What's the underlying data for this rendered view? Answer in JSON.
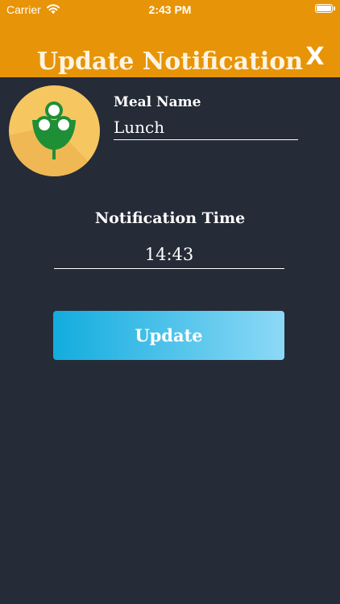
{
  "status_bar": {
    "carrier": "Carrier",
    "time": "2:43 PM"
  },
  "header": {
    "title": "Update Notification",
    "close_label": "X"
  },
  "meal": {
    "label": "Meal Name",
    "value": "Lunch"
  },
  "notification": {
    "label": "Notification Time",
    "value": "14:43"
  },
  "actions": {
    "update_label": "Update"
  },
  "colors": {
    "header_bg": "#e89408",
    "page_bg": "#252b37",
    "button_start": "#12acde",
    "button_end": "#8cd9f6",
    "avatar_bg": "#f6c660",
    "logo_green": "#1e8f35"
  },
  "icons": {
    "wifi": "wifi-icon",
    "battery": "battery-icon",
    "logo": "meal-logo-icon"
  }
}
